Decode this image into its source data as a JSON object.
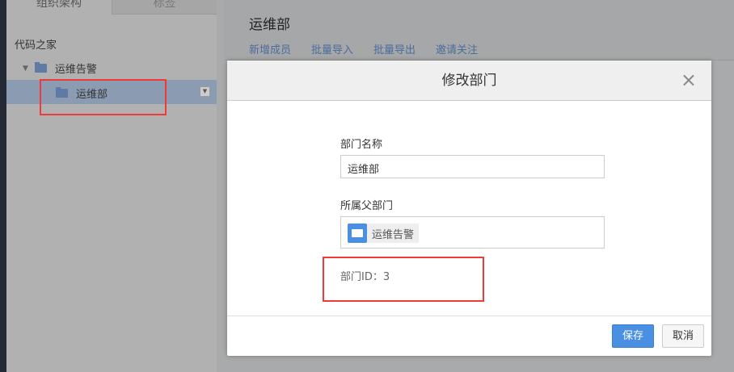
{
  "sidebar": {
    "tabs": [
      "组织架构",
      "标签"
    ],
    "root": "代码之家",
    "nodes": [
      {
        "label": "运维告警"
      },
      {
        "label": "运维部"
      }
    ]
  },
  "main": {
    "title": "运维部",
    "actions": [
      "新增成员",
      "批量导入",
      "批量导出",
      "邀请关注"
    ]
  },
  "modal": {
    "title": "修改部门",
    "name_label": "部门名称",
    "name_value": "运维部",
    "parent_label": "所属父部门",
    "parent_value": "运维告警",
    "id_text": "部门ID：3",
    "save": "保存",
    "cancel": "取消"
  },
  "colors": {
    "primary": "#4a90e2",
    "highlight": "#f03a3a"
  }
}
